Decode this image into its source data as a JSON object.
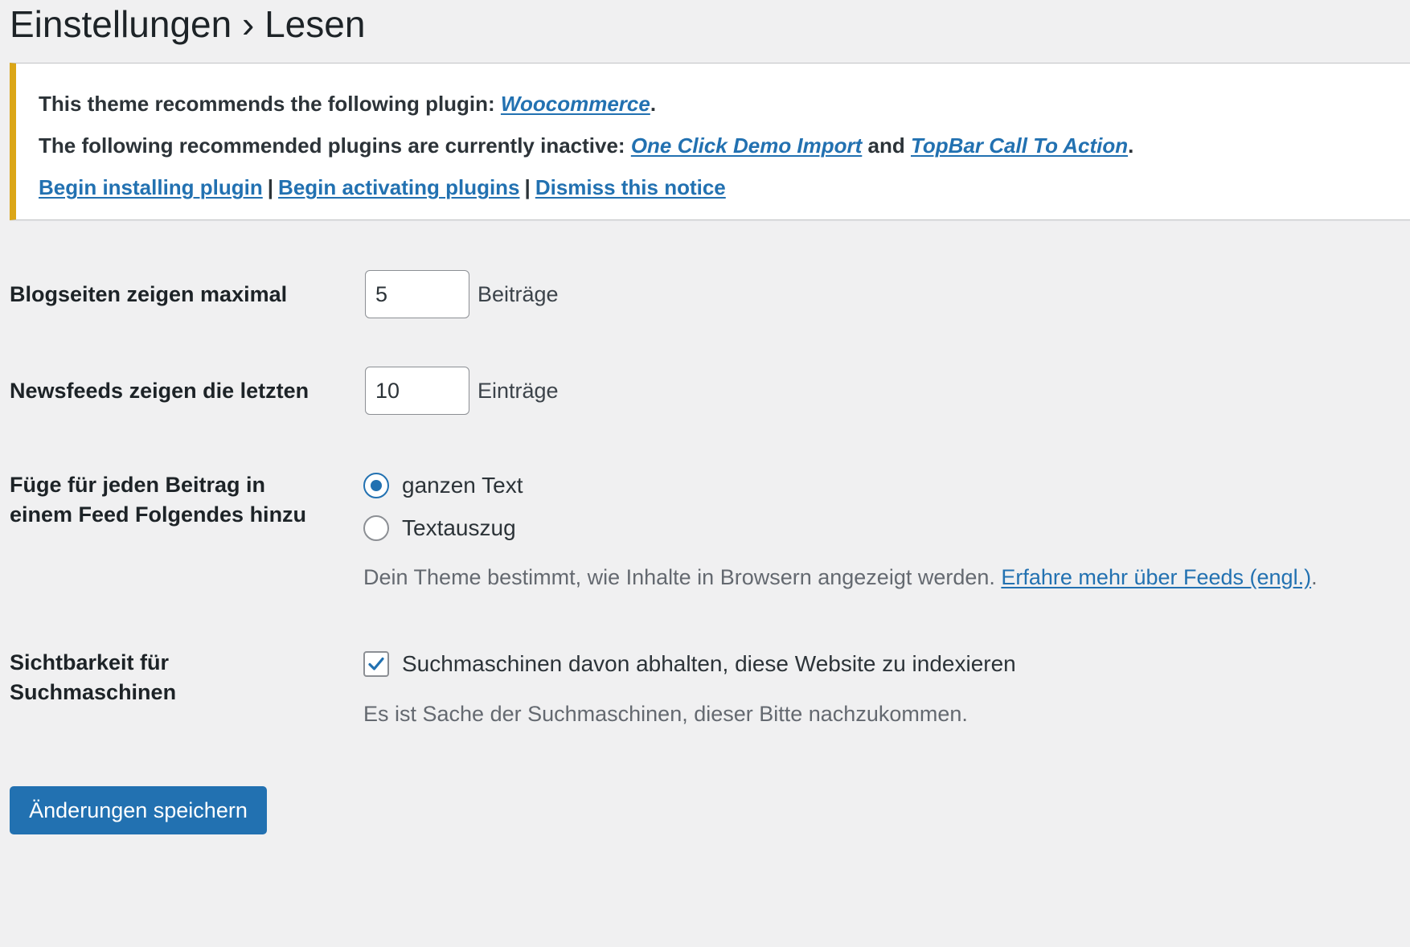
{
  "page": {
    "title": "Einstellungen › Lesen"
  },
  "notice": {
    "line1_prefix": "This theme recommends the following plugin: ",
    "line1_link": "Woocommerce",
    "line1_suffix": ".",
    "line2_prefix": "The following recommended plugins are currently inactive: ",
    "line2_link1": "One Click Demo Import",
    "line2_and": " and ",
    "line2_link2": "TopBar Call To Action",
    "line2_suffix": ".",
    "action_install": "Begin installing plugin",
    "action_activate": "Begin activating plugins",
    "action_dismiss": "Dismiss this notice",
    "separator": "|",
    "accent_color": "#dba617"
  },
  "settings": {
    "posts_per_page": {
      "label": "Blogseiten zeigen maximal",
      "value": "5",
      "unit": "Beiträge"
    },
    "posts_per_rss": {
      "label": "Newsfeeds zeigen die letzten",
      "value": "10",
      "unit": "Einträge"
    },
    "rss_use_excerpt": {
      "label_line1": "Füge für jeden Beitrag in",
      "label_line2": "einem Feed Folgendes hinzu",
      "options": [
        {
          "label": "ganzen Text",
          "checked": true
        },
        {
          "label": "Textauszug",
          "checked": false
        }
      ],
      "description": "Dein Theme bestimmt, wie Inhalte in Browsern angezeigt werden. ",
      "description_link": "Erfahre mehr über Feeds (engl.)",
      "description_suffix": "."
    },
    "blog_public": {
      "label_line1": "Sichtbarkeit für",
      "label_line2": "Suchmaschinen",
      "checkbox_label": "Suchmaschinen davon abhalten, diese Website zu indexieren",
      "checked": true,
      "description": "Es ist Sache der Suchmaschinen, dieser Bitte nachzukommen."
    }
  },
  "submit": {
    "label": "Änderungen speichern"
  },
  "colors": {
    "primary": "#2271b1",
    "background": "#f0f0f1",
    "text": "#1d2327"
  }
}
